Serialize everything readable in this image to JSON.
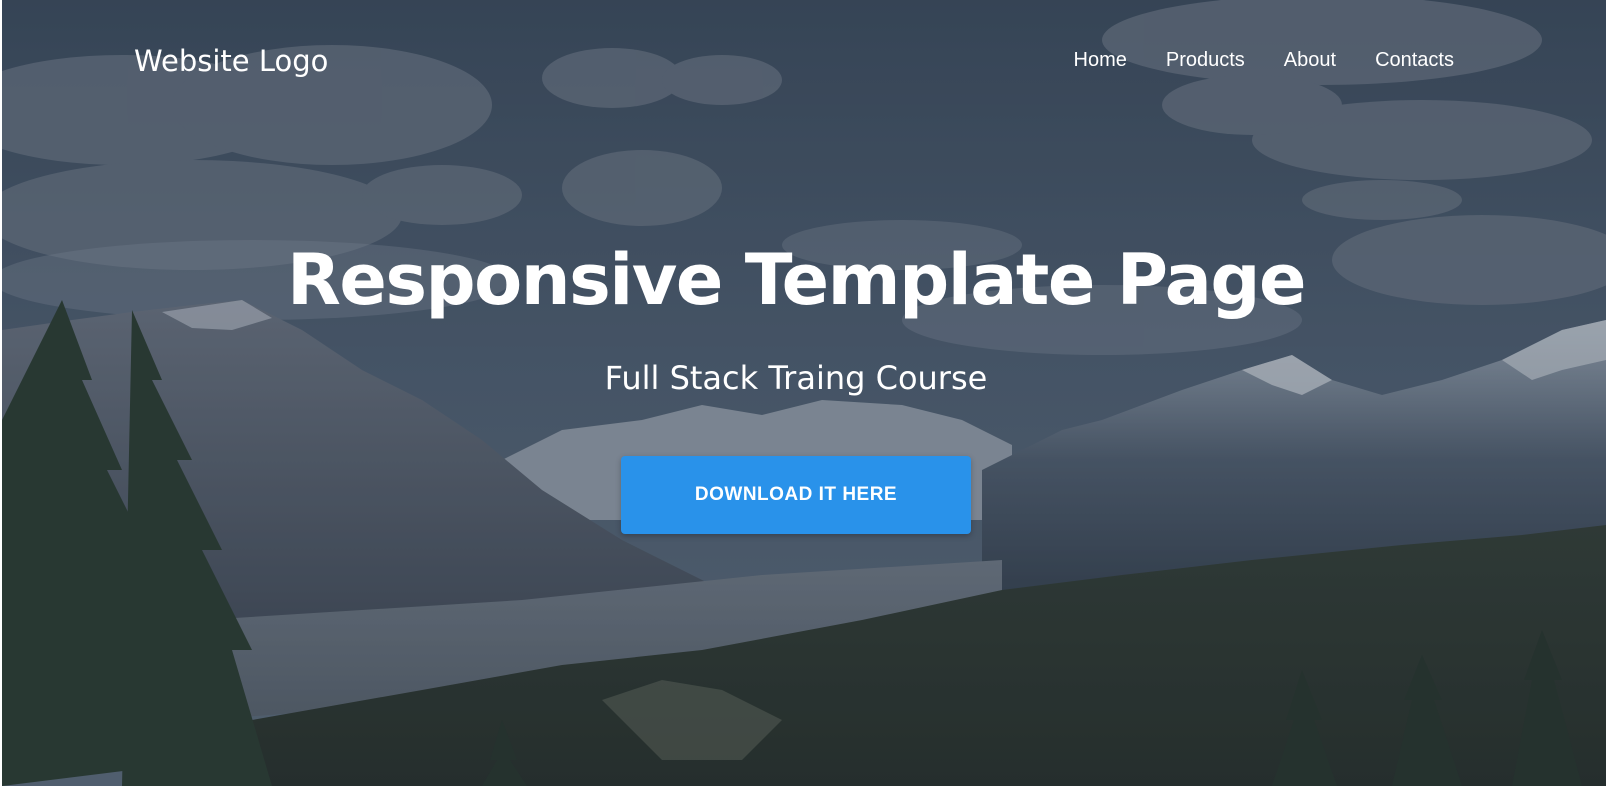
{
  "header": {
    "logo": "Website Logo",
    "nav": [
      {
        "label": "Home"
      },
      {
        "label": "Products"
      },
      {
        "label": "About"
      },
      {
        "label": "Contacts"
      }
    ]
  },
  "hero": {
    "title": "Responsive Template Page",
    "subtitle": "Full Stack Traing Course",
    "cta_label": "DOWNLOAD IT HERE",
    "background": "mountain-landscape-photo"
  },
  "colors": {
    "overlay": "#3b4c5e",
    "cta": "#2992ea",
    "text": "#ffffff"
  }
}
